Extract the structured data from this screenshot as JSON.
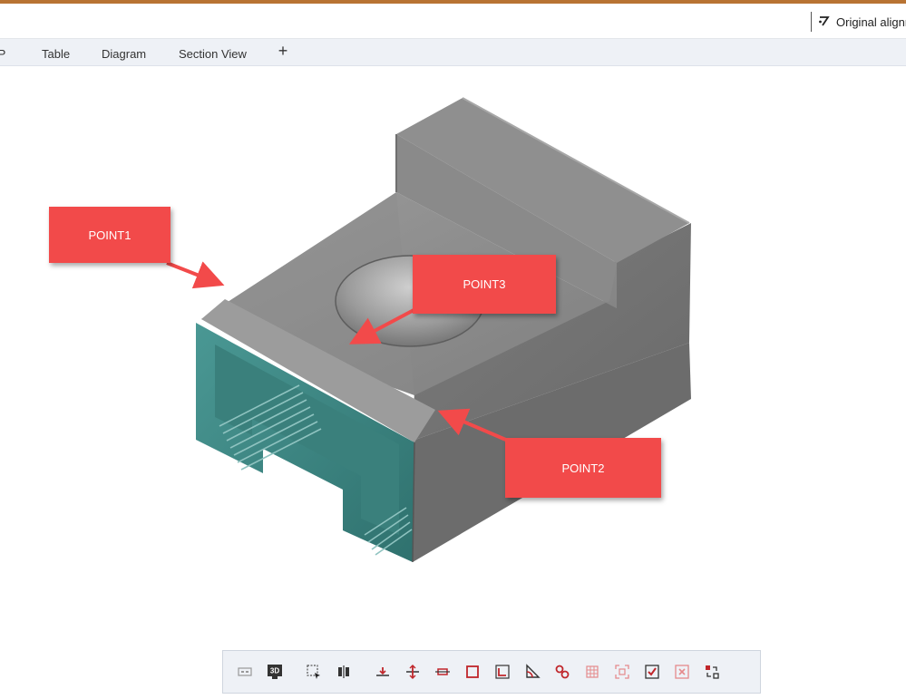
{
  "header": {
    "align_label": "Original alignr"
  },
  "tabs": [
    {
      "name": "tab-ip",
      "label": "IP"
    },
    {
      "name": "tab-table",
      "label": "Table"
    },
    {
      "name": "tab-diagram",
      "label": "Diagram"
    },
    {
      "name": "tab-section-view",
      "label": "Section View"
    }
  ],
  "tab_add_label": "+",
  "callouts": {
    "point1": "POINT1",
    "point2": "POINT2",
    "point3": "POINT3"
  },
  "toolbar": {
    "view_3d_label": "3D"
  },
  "colors": {
    "accent": "#b87333",
    "callout": "#f24a4a",
    "part_gray": "#8a8a8a",
    "part_teal": "#3f8c88",
    "icon_red": "#c0262b"
  }
}
